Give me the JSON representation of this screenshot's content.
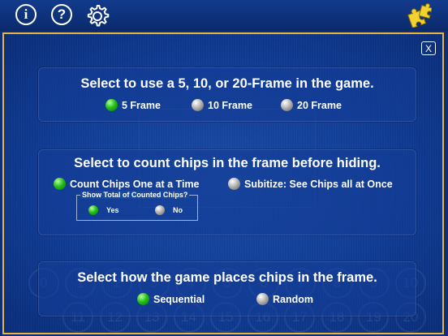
{
  "toolbar": {
    "info_glyph": "i",
    "help_glyph": "?",
    "icons": [
      "info-icon",
      "help-icon",
      "gear-icon",
      "puzzle-icon"
    ],
    "accent": "#e8b43a"
  },
  "dialog": {
    "close_glyph": "X",
    "background_numbers": {
      "row1": [
        "0",
        "1",
        "2",
        "3",
        "4",
        "5",
        "6",
        "7",
        "8",
        "9",
        "10"
      ],
      "row2": [
        "11",
        "12",
        "13",
        "14",
        "15",
        "16",
        "17",
        "18",
        "19",
        "20"
      ]
    },
    "frame_section": {
      "title": "Select to use a 5, 10, or 20-Frame in the game.",
      "options": [
        {
          "label": "5 Frame",
          "selected": true
        },
        {
          "label": "10 Frame",
          "selected": false
        },
        {
          "label": "20 Frame",
          "selected": false
        }
      ]
    },
    "count_section": {
      "title": "Select to count chips in the frame before hiding.",
      "options": [
        {
          "label": "Count Chips One at a Time",
          "selected": true
        },
        {
          "label": "Subitize: See Chips all at Once",
          "selected": false
        }
      ],
      "show_total": {
        "title": "Show Total of Counted Chips?",
        "options": [
          {
            "label": "Yes",
            "selected": true
          },
          {
            "label": "No",
            "selected": false
          }
        ]
      }
    },
    "placement_section": {
      "title": "Select how the game places chips in the frame.",
      "options": [
        {
          "label": "Sequential",
          "selected": true
        },
        {
          "label": "Random",
          "selected": false
        }
      ]
    }
  }
}
